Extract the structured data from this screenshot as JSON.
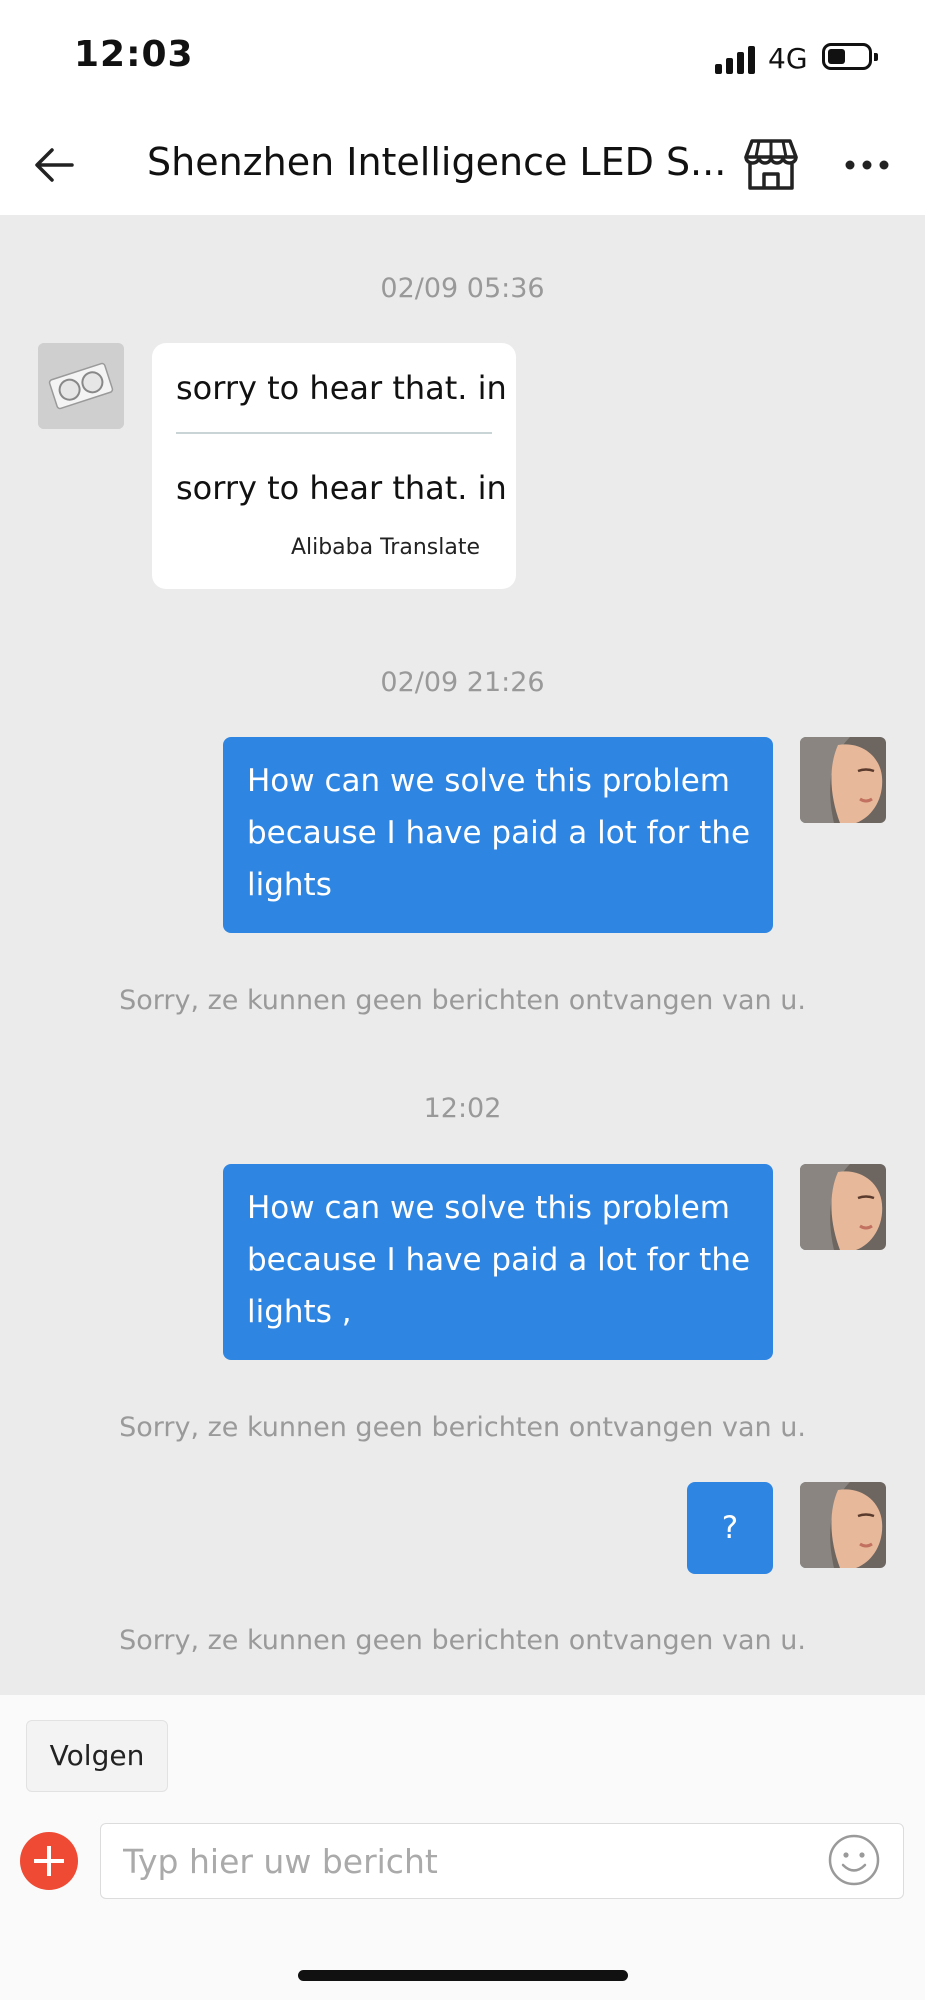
{
  "status": {
    "time": "12:03",
    "network": "4G",
    "battery_level": 0.45
  },
  "header": {
    "back_icon": "arrow-left-icon",
    "title": "Shenzhen Intelligence LED S...",
    "shop_icon": "storefront-icon",
    "more_icon": "more-horizontal-icon"
  },
  "chat": {
    "timestamp_1": "02/09 05:36",
    "incoming": {
      "original": "sorry to hear that. in",
      "translated": "sorry to hear that. in",
      "credit": "Alibaba Translate"
    },
    "timestamp_2": "02/09 21:26",
    "msg_1": "How can we solve this problem because I have paid a lot for the lights",
    "notice_1": "Sorry, ze kunnen geen berichten ontvangen van u.",
    "timestamp_3": "12:02",
    "msg_2": "How can we solve this problem because I have paid a lot for the lights ,",
    "notice_2": "Sorry, ze kunnen geen berichten ontvangen van u.",
    "msg_3": "?",
    "notice_3": "Sorry, ze kunnen geen berichten ontvangen van u."
  },
  "footer": {
    "follow_label": "Volgen",
    "input_placeholder": "Typ hier uw bericht",
    "add_icon": "plus-circle-icon",
    "emoji_icon": "smiley-icon"
  },
  "colors": {
    "outgoing_bubble": "#2f86e2",
    "chat_background": "#ebebeb",
    "add_button": "#ef4a34"
  }
}
